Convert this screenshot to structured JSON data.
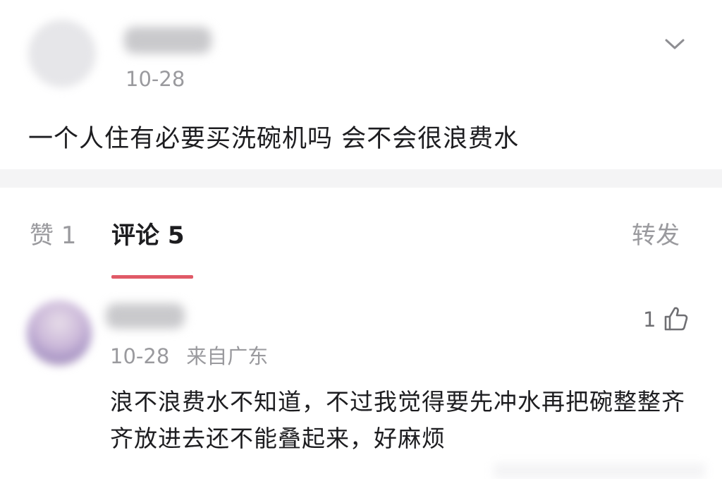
{
  "post": {
    "date": "10-28",
    "text": "一个人住有必要买洗碗机吗 会不会很浪费水"
  },
  "tabs": {
    "likes": "赞 1",
    "comments": "评论 5",
    "shares": "转发"
  },
  "comment": {
    "date": "10-28",
    "location": "来自广东",
    "like_count": "1",
    "text": "浪不浪费水不知道，不过我觉得要先冲水再把碗整整齐齐放进去还不能叠起来，好麻烦"
  },
  "colors": {
    "accent": "#e05a67",
    "muted_text": "#9a9a9e",
    "main_text": "#1d1d20"
  },
  "icons": [
    "chevron-down-icon",
    "thumbs-up-icon"
  ]
}
